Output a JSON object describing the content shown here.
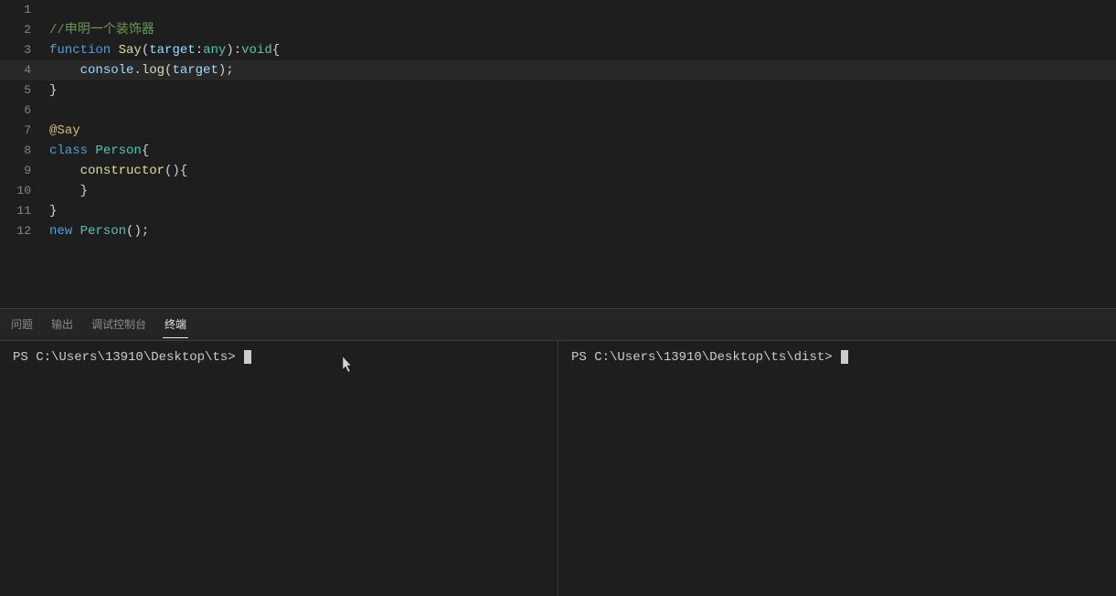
{
  "editor": {
    "lines": [
      {
        "num": 1,
        "content": "",
        "active": false
      },
      {
        "num": 2,
        "content": "//申明一个装饰器",
        "active": false,
        "comment": true
      },
      {
        "num": 3,
        "content": null,
        "active": false,
        "code": "line3"
      },
      {
        "num": 4,
        "content": null,
        "active": true,
        "code": "line4"
      },
      {
        "num": 5,
        "content": "}",
        "active": false
      },
      {
        "num": 6,
        "content": "",
        "active": false
      },
      {
        "num": 7,
        "content": null,
        "active": false,
        "code": "line7"
      },
      {
        "num": 8,
        "content": null,
        "active": false,
        "code": "line8"
      },
      {
        "num": 9,
        "content": null,
        "active": false,
        "code": "line9"
      },
      {
        "num": 10,
        "content": null,
        "active": false,
        "code": "line10"
      },
      {
        "num": 11,
        "content": "}",
        "active": false
      },
      {
        "num": 12,
        "content": null,
        "active": false,
        "code": "line12"
      }
    ]
  },
  "panel": {
    "tabs": [
      "问题",
      "输出",
      "调试控制台",
      "终端"
    ],
    "activeTab": "终端"
  },
  "terminal": {
    "left": {
      "prompt": "PS C:\\Users\\13910\\Desktop\\ts> "
    },
    "right": {
      "prompt": "PS C:\\Users\\13910\\Desktop\\ts\\dist> "
    }
  }
}
